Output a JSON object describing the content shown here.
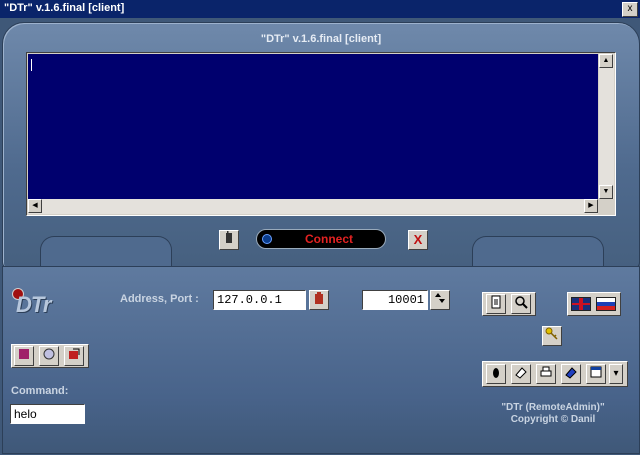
{
  "window": {
    "title": "\"DTr\" v.1.6.final [client]",
    "close_glyph": "x"
  },
  "panel": {
    "title": "\"DTr\" v.1.6.final [client]"
  },
  "console": {
    "text": ""
  },
  "toolbar": {
    "connect_label": "Connect",
    "close_glyph": "X"
  },
  "connection": {
    "address_port_label": "Address, Port :",
    "address_value": "127.0.0.1",
    "port_value": "10001"
  },
  "command": {
    "label": "Command:",
    "value": "helo"
  },
  "logo": {
    "text": "DTr"
  },
  "footer": {
    "line1": "\"DTr (RemoteAdmin)\"",
    "line2": "Copyright © Danil"
  },
  "icons": {
    "scroll_up": "▲",
    "scroll_down": "▼",
    "scroll_left": "◀",
    "scroll_right": "▶",
    "dropdown": "▾",
    "key": "🔑"
  },
  "colors": {
    "console_bg": "#00006e",
    "connect_text": "#e32222",
    "panel": "#4f6a8e"
  }
}
